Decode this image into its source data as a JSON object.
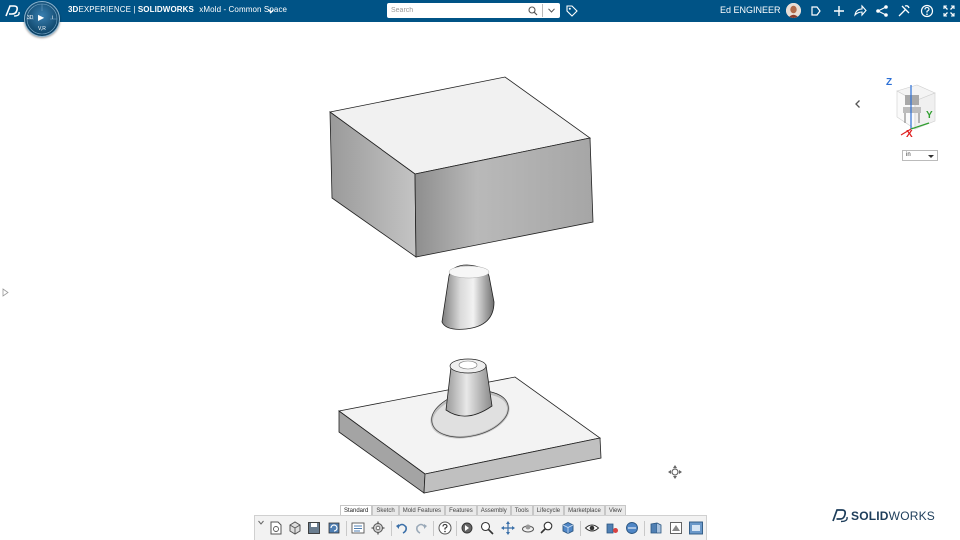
{
  "header": {
    "brand_bold": "3D",
    "brand_rest": "EXPERIENCE",
    "separator": " | ",
    "product": "SOLIDWORKS",
    "app_name": "xMold",
    "space_sep": " - ",
    "space_name": "Common Space",
    "compass": {
      "left": "3D",
      "center": "▶",
      "bottom": "V,R",
      "right": "i"
    },
    "search": {
      "placeholder": "Search",
      "value": ""
    },
    "username": "Ed ENGINEER",
    "icons": [
      "tag-icon",
      "notifications-icon",
      "add-icon",
      "share-icon",
      "network-icon",
      "tools-icon",
      "help-icon",
      "fullscreen-icon"
    ]
  },
  "viewport": {
    "triad": {
      "x_label": "X",
      "y_label": "Y",
      "z_label": "Z"
    },
    "units": {
      "value": "in"
    },
    "colors": {
      "x_axis": "#e02020",
      "y_axis": "#2f9f2f",
      "z_axis": "#2b6fd6"
    }
  },
  "command_manager": {
    "tabs": [
      {
        "label": "Standard",
        "active": true
      },
      {
        "label": "Sketch",
        "active": false
      },
      {
        "label": "Mold Features",
        "active": false
      },
      {
        "label": "Features",
        "active": false
      },
      {
        "label": "Assembly",
        "active": false
      },
      {
        "label": "Tools",
        "active": false
      },
      {
        "label": "Lifecycle",
        "active": false
      },
      {
        "label": "Marketplace",
        "active": false
      },
      {
        "label": "View",
        "active": false
      }
    ],
    "tools": [
      "new-document-icon",
      "open-icon",
      "save-icon",
      "rebuild-icon",
      "options-icon",
      "settings-gear-icon",
      "undo-icon",
      "redo-icon",
      "help-icon",
      "rotate-view-icon",
      "zoom-icon",
      "pan-icon",
      "rotate-icon",
      "zoom-area-icon",
      "view-cube-icon",
      "hide-show-icon",
      "appearance-icon",
      "scene-icon",
      "section-view-icon",
      "display-style-icon",
      "view-orientation-icon"
    ]
  },
  "branding": {
    "logo_text_bold": "SOLID",
    "logo_text_rest": "WORKS"
  }
}
